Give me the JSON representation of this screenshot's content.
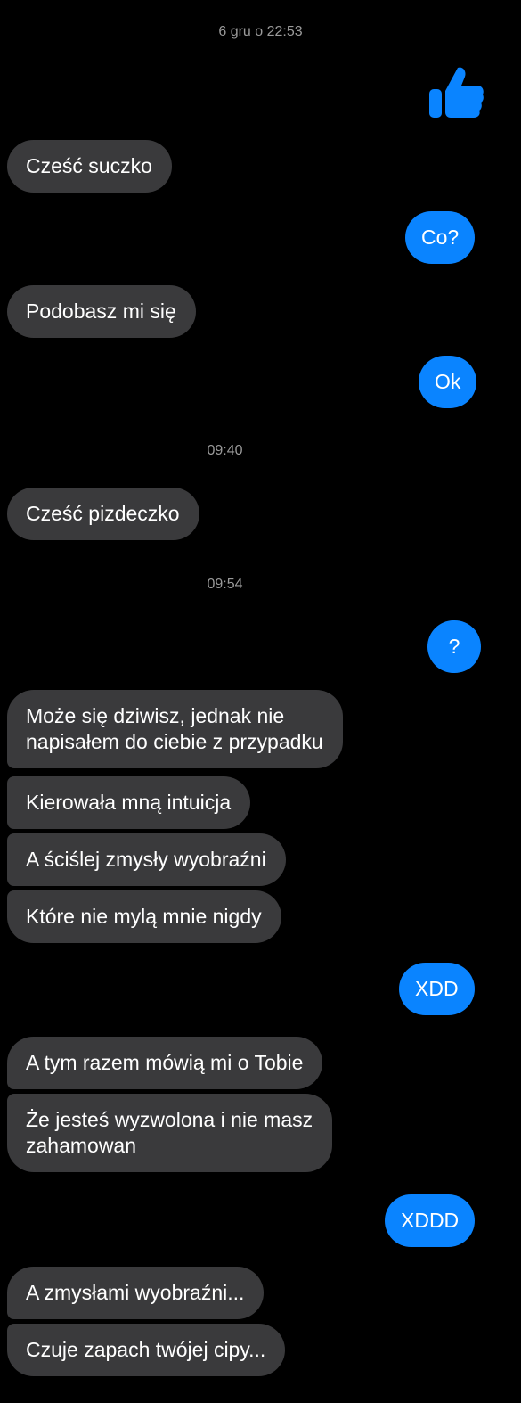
{
  "timestamps": {
    "t1": "6 gru o 22:53",
    "t2": "09:40",
    "t3": "09:54"
  },
  "like_icon": "thumbs-up-icon",
  "colors": {
    "background": "#000000",
    "incoming_bubble": "#3a3a3c",
    "outgoing_bubble": "#0a84ff",
    "timestamp_text": "#9a9a9a"
  },
  "messages": {
    "m1": "Cześć suczko",
    "m2": "Co?",
    "m3": "Podobasz mi się",
    "m4": "Ok",
    "m5": "Cześć pizdeczko",
    "m6": "?",
    "m7": "Może się dziwisz, jednak nie\nnapisałem do ciebie z przypadku",
    "m8": "Kierowała mną intuicja",
    "m9": "A ściślej zmysły wyobraźni",
    "m10": "Które nie mylą mnie nigdy",
    "m11": "XDD",
    "m12": "A tym razem mówią mi o Tobie",
    "m13": "Że jesteś wyzwolona i nie masz\nzahamowan",
    "m14": "XDDD",
    "m15": "A zmysłami wyobraźni...",
    "m16": "Czuje zapach twójej cipy..."
  }
}
